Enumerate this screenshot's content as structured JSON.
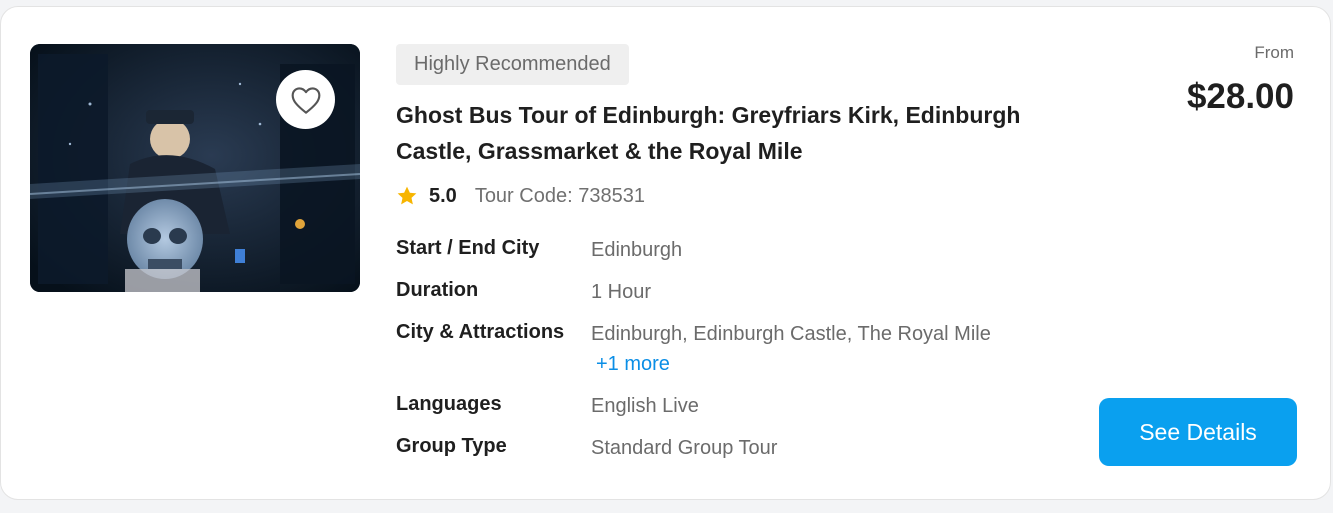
{
  "product": {
    "badge": "Highly Recommended",
    "title": "Ghost Bus Tour of Edinburgh: Greyfriars Kirk, Edinburgh Castle, Grassmarket & the Royal Mile",
    "rating": "5.0",
    "tour_code": "Tour Code: 738531",
    "icons": {
      "favorite": "heart-outline-icon",
      "rating": "star-icon"
    },
    "colors": {
      "accent": "#0aa0ef",
      "star": "#f7b500",
      "link": "#0a8ee6"
    }
  },
  "details": {
    "rows": [
      {
        "label": "Start / End City",
        "value": "Edinburgh"
      },
      {
        "label": "Duration",
        "value": "1 Hour"
      },
      {
        "label": "City & Attractions",
        "value": "Edinburgh, Edinburgh Castle, The Royal Mile",
        "more": "+1 more"
      },
      {
        "label": "Languages",
        "value": "English Live"
      },
      {
        "label": "Group Type",
        "value": "Standard Group Tour"
      }
    ]
  },
  "pricing": {
    "from_label": "From",
    "price": "$28.00",
    "cta_label": "See Details"
  }
}
